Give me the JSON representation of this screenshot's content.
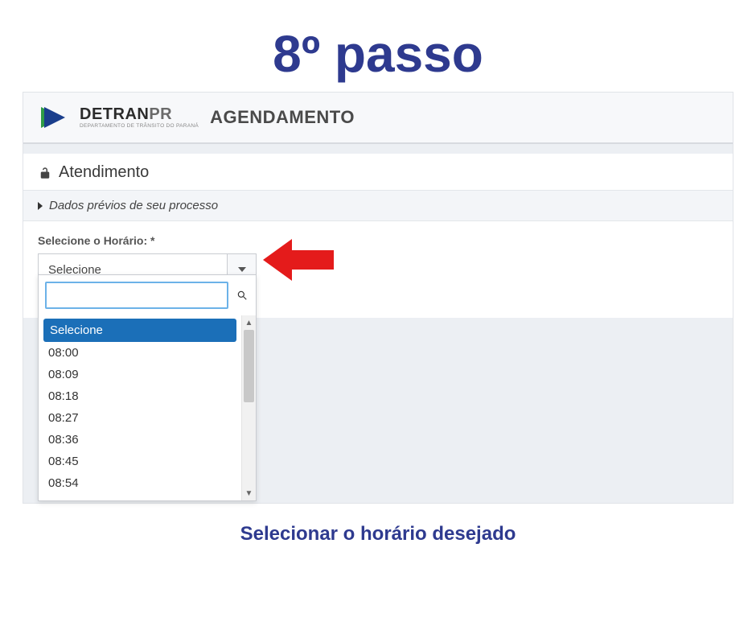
{
  "step_title": "8º passo",
  "header": {
    "brand_main": "DETRAN",
    "brand_suffix": "PR",
    "brand_sub": "DEPARTAMENTO DE TRÂNSITO DO PARANÁ",
    "app_title": "AGENDAMENTO"
  },
  "section": {
    "heading": "Atendimento",
    "accordion_label": "Dados prévios de seu processo"
  },
  "form": {
    "field_label": "Selecione o Horário: *",
    "select_value": "Selecione"
  },
  "dropdown": {
    "search_value": "",
    "items": [
      {
        "label": "Selecione",
        "selected": true
      },
      {
        "label": "08:00",
        "selected": false
      },
      {
        "label": "08:09",
        "selected": false
      },
      {
        "label": "08:18",
        "selected": false
      },
      {
        "label": "08:27",
        "selected": false
      },
      {
        "label": "08:36",
        "selected": false
      },
      {
        "label": "08:45",
        "selected": false
      },
      {
        "label": "08:54",
        "selected": false
      }
    ]
  },
  "instruction": "Selecionar o horário desejado"
}
